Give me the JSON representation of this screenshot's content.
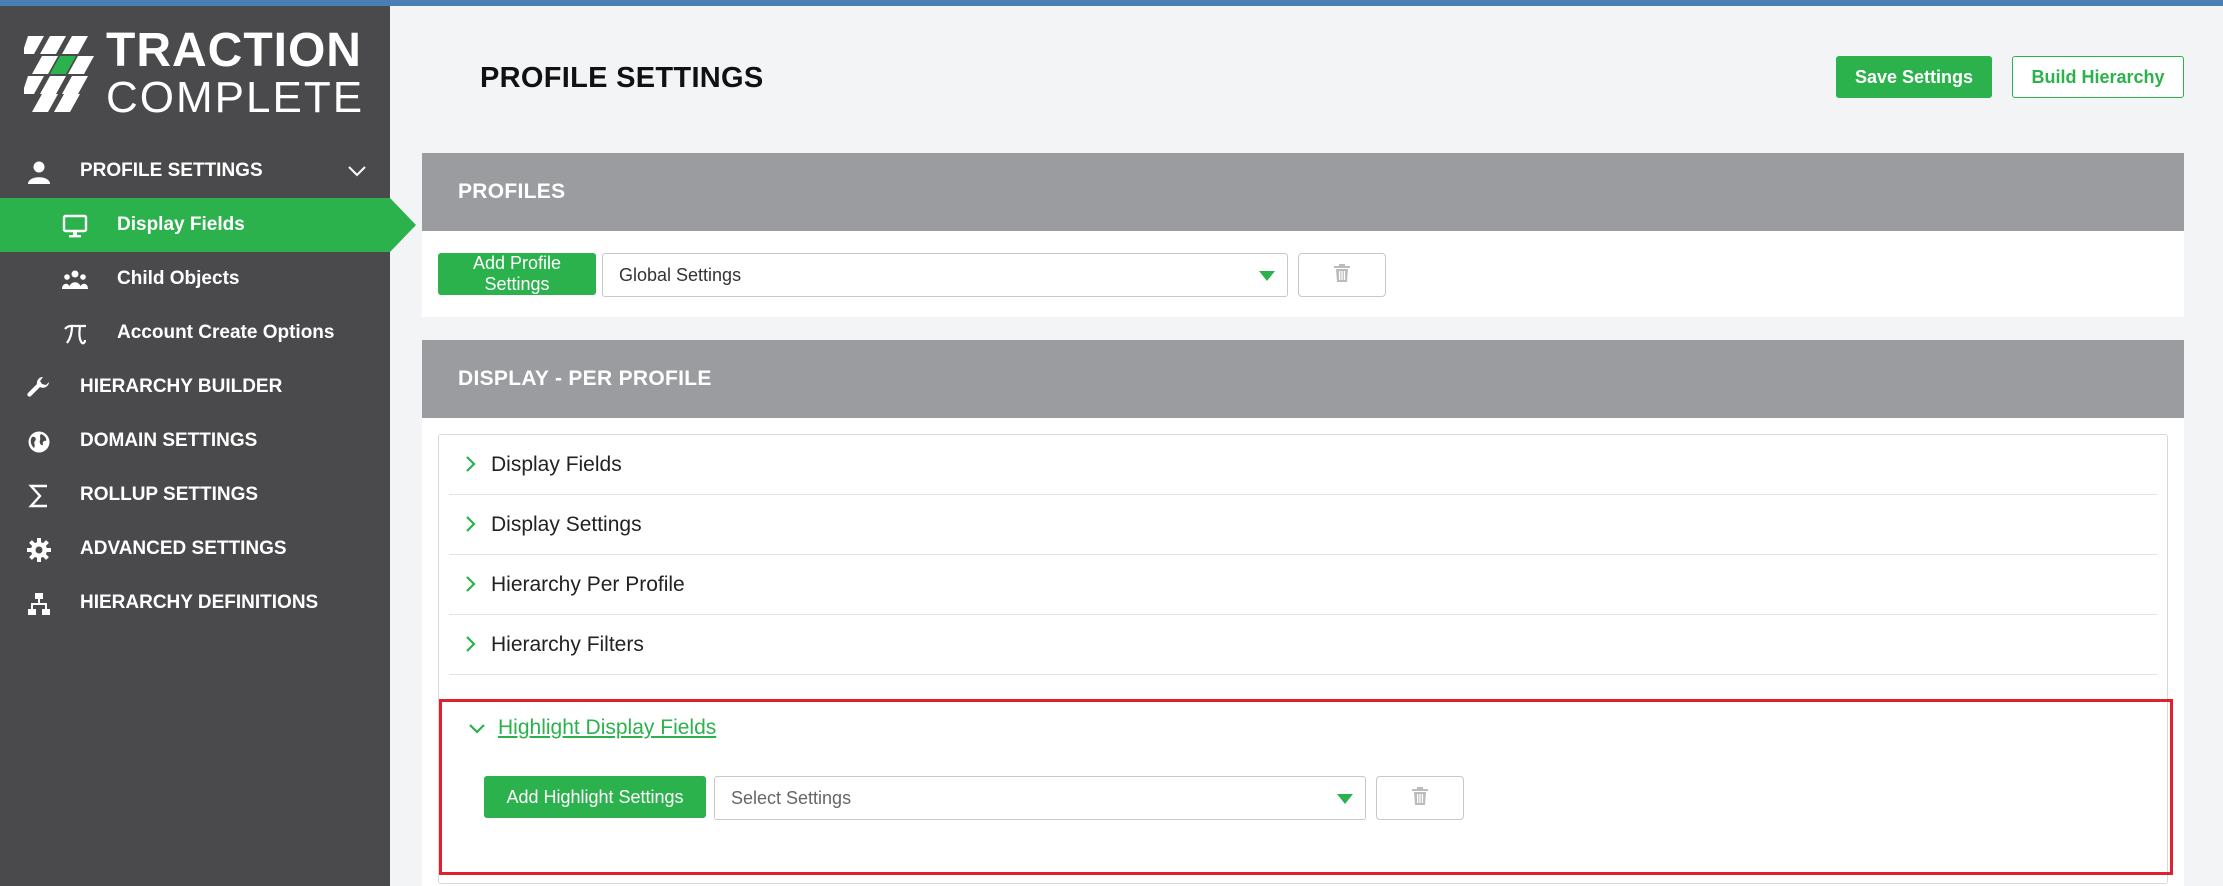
{
  "brand": {
    "line1": "TRACTION",
    "line2": "COMPLETE"
  },
  "sidebar": {
    "items": [
      {
        "label": "PROFILE SETTINGS",
        "icon": "user-icon"
      },
      {
        "label": "Display Fields",
        "icon": "monitor-icon"
      },
      {
        "label": "Child Objects",
        "icon": "people-icon"
      },
      {
        "label": "Account Create Options",
        "icon": "pi-icon"
      },
      {
        "label": "HIERARCHY BUILDER",
        "icon": "wrench-icon"
      },
      {
        "label": "DOMAIN SETTINGS",
        "icon": "globe-icon"
      },
      {
        "label": "ROLLUP SETTINGS",
        "icon": "sigma-icon"
      },
      {
        "label": "ADVANCED SETTINGS",
        "icon": "gear-icon"
      },
      {
        "label": "HIERARCHY DEFINITIONS",
        "icon": "sitemap-icon"
      }
    ]
  },
  "header": {
    "title": "PROFILE SETTINGS",
    "save_label": "Save Settings",
    "build_label": "Build Hierarchy"
  },
  "profiles": {
    "title": "PROFILES",
    "add_label": "Add Profile Settings",
    "selected": "Global Settings"
  },
  "display": {
    "title": "DISPLAY - PER PROFILE",
    "sections": [
      {
        "label": "Display Fields"
      },
      {
        "label": "Display Settings"
      },
      {
        "label": "Hierarchy Per Profile"
      },
      {
        "label": "Hierarchy Filters"
      }
    ],
    "highlight": {
      "title": "Highlight Display Fields",
      "add_label": "Add Highlight Settings",
      "select_placeholder": "Select Settings"
    }
  },
  "colors": {
    "accent": "#2bb24c",
    "sidebar": "#4a4a4c",
    "section_header": "#9b9ca0",
    "highlight_border": "#e0202c"
  }
}
